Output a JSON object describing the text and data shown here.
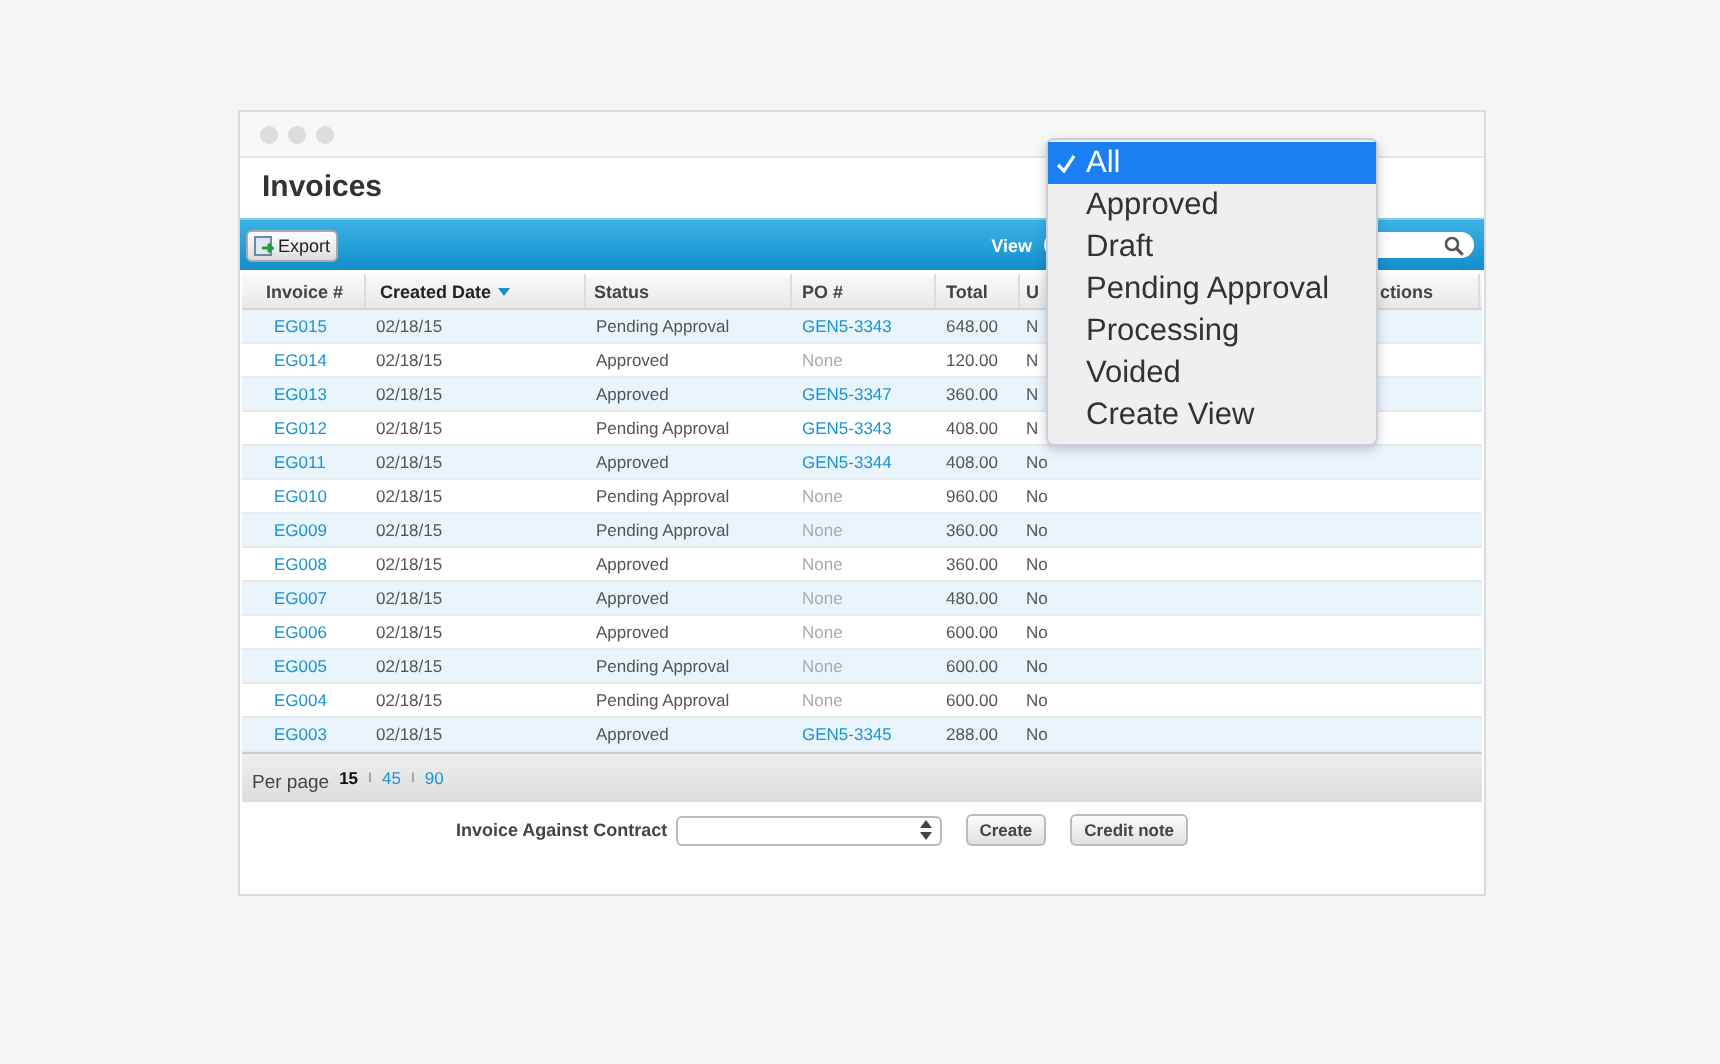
{
  "window": {
    "title": "Invoices"
  },
  "toolbar": {
    "export_label": "Export",
    "view_label": "View"
  },
  "table": {
    "columns": [
      {
        "label": "Invoice #",
        "sorted": false
      },
      {
        "label": "Created Date",
        "sorted": true
      },
      {
        "label": "Status",
        "sorted": false
      },
      {
        "label": "PO #",
        "sorted": false
      },
      {
        "label": "Total",
        "sorted": false
      },
      {
        "label": "U",
        "sorted": false
      },
      {
        "label": "ctions",
        "sorted": false
      }
    ],
    "rows": [
      {
        "invoice": "EG015",
        "date": "02/18/15",
        "status": "Pending Approval",
        "po": "GEN5-3343",
        "po_linked": true,
        "total": "648.00",
        "u": "N"
      },
      {
        "invoice": "EG014",
        "date": "02/18/15",
        "status": "Approved",
        "po": "None",
        "po_linked": false,
        "total": "120.00",
        "u": "N"
      },
      {
        "invoice": "EG013",
        "date": "02/18/15",
        "status": "Approved",
        "po": "GEN5-3347",
        "po_linked": true,
        "total": "360.00",
        "u": "N"
      },
      {
        "invoice": "EG012",
        "date": "02/18/15",
        "status": "Pending Approval",
        "po": "GEN5-3343",
        "po_linked": true,
        "total": "408.00",
        "u": "N"
      },
      {
        "invoice": "EG011",
        "date": "02/18/15",
        "status": "Approved",
        "po": "GEN5-3344",
        "po_linked": true,
        "total": "408.00",
        "u": "No"
      },
      {
        "invoice": "EG010",
        "date": "02/18/15",
        "status": "Pending Approval",
        "po": "None",
        "po_linked": false,
        "total": "960.00",
        "u": "No"
      },
      {
        "invoice": "EG009",
        "date": "02/18/15",
        "status": "Pending Approval",
        "po": "None",
        "po_linked": false,
        "total": "360.00",
        "u": "No"
      },
      {
        "invoice": "EG008",
        "date": "02/18/15",
        "status": "Approved",
        "po": "None",
        "po_linked": false,
        "total": "360.00",
        "u": "No"
      },
      {
        "invoice": "EG007",
        "date": "02/18/15",
        "status": "Approved",
        "po": "None",
        "po_linked": false,
        "total": "480.00",
        "u": "No"
      },
      {
        "invoice": "EG006",
        "date": "02/18/15",
        "status": "Approved",
        "po": "None",
        "po_linked": false,
        "total": "600.00",
        "u": "No"
      },
      {
        "invoice": "EG005",
        "date": "02/18/15",
        "status": "Pending Approval",
        "po": "None",
        "po_linked": false,
        "total": "600.00",
        "u": "No"
      },
      {
        "invoice": "EG004",
        "date": "02/18/15",
        "status": "Pending Approval",
        "po": "None",
        "po_linked": false,
        "total": "600.00",
        "u": "No"
      },
      {
        "invoice": "EG003",
        "date": "02/18/15",
        "status": "Approved",
        "po": "GEN5-3345",
        "po_linked": true,
        "total": "288.00",
        "u": "No"
      }
    ]
  },
  "pagination": {
    "label": "Per page",
    "options": [
      {
        "label": "15",
        "selected": true
      },
      {
        "label": "45",
        "selected": false
      },
      {
        "label": "90",
        "selected": false
      }
    ],
    "separators": [
      "I",
      "I"
    ]
  },
  "contract_form": {
    "label": "Invoice Against Contract",
    "buttons": [
      "Create",
      "Credit note"
    ]
  },
  "view_menu": {
    "items": [
      {
        "label": "All",
        "selected": true
      },
      {
        "label": "Approved",
        "selected": false
      },
      {
        "label": "Draft",
        "selected": false
      },
      {
        "label": "Pending Approval",
        "selected": false
      },
      {
        "label": "Processing",
        "selected": false
      },
      {
        "label": "Voided",
        "selected": false
      },
      {
        "label": "Create View",
        "selected": false
      }
    ]
  }
}
